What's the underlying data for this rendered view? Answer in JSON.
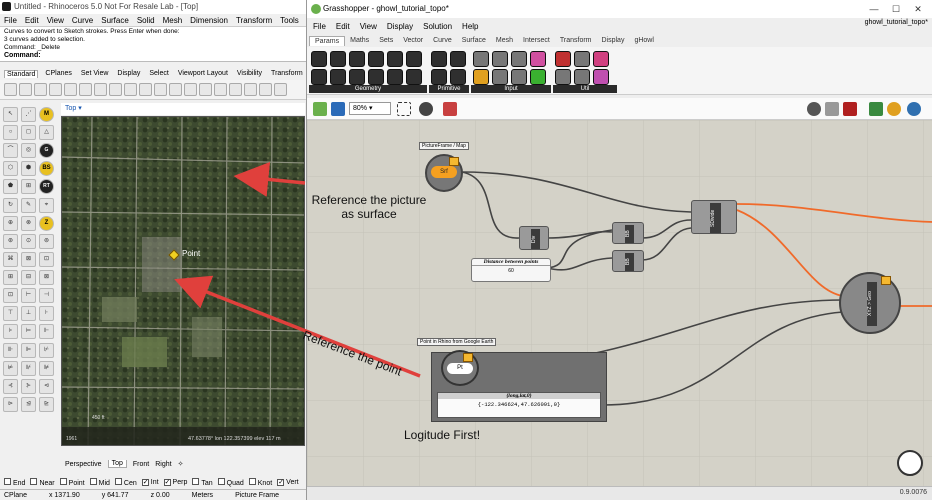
{
  "rhino": {
    "title": "Untitled - Rhinoceros 5.0 Not For Resale Lab - [Top]",
    "menu": [
      "File",
      "Edit",
      "View",
      "Curve",
      "Surface",
      "Solid",
      "Mesh",
      "Dimension",
      "Transform",
      "Tools",
      "Analy"
    ],
    "command_history": [
      "Curves to convert to Sketch strokes. Press Enter when done:",
      "3 curves added to selection.",
      "Command: _Delete"
    ],
    "command_prompt": "Command:",
    "toolbar_tabs": [
      "Standard",
      "CPlanes",
      "Set View",
      "Display",
      "Select",
      "Viewport Layout",
      "Visibility",
      "Transform"
    ],
    "left_tools": [
      "↖",
      "⋰",
      "⌒",
      "○",
      "◻",
      "△",
      "⌒",
      "◎",
      "⊡",
      "⬡",
      "⬢",
      "◆",
      "⬟",
      "⊞",
      "⊟",
      "↻",
      "✎",
      "⌖",
      "⊕",
      "⊗",
      "⊘",
      "⊛",
      "⊙",
      "⊚",
      "⌘",
      "⊠",
      "⊡",
      "⊞",
      "⊟",
      "⊠",
      "⊡",
      "⊢",
      "⊣",
      "⊤",
      "⊥",
      "⊦",
      "⊧",
      "⊨",
      "⊩",
      "⊪",
      "⊫",
      "⊬",
      "⊭",
      "⊮",
      "⊯",
      "⊰",
      "⊱",
      "⊲",
      "⊳",
      "⊴",
      "⊵"
    ],
    "left_tool_badges": [
      "M",
      "G",
      "BS",
      "RT",
      "Z"
    ],
    "viewport_label": "Top",
    "viewport_point_label": "Point",
    "viewport_coords": "47.63778° lon 122.357399 elev 117 m",
    "viewport_year": "1961",
    "viewport_scale": "450 ft",
    "viewport_tabs": [
      "Perspective",
      "Top",
      "Front",
      "Right",
      "✧"
    ],
    "osnaps": [
      {
        "label": "End",
        "on": false
      },
      {
        "label": "Near",
        "on": false
      },
      {
        "label": "Point",
        "on": false
      },
      {
        "label": "Mid",
        "on": false
      },
      {
        "label": "Cen",
        "on": false
      },
      {
        "label": "Int",
        "on": true
      },
      {
        "label": "Perp",
        "on": true
      },
      {
        "label": "Tan",
        "on": false
      },
      {
        "label": "Quad",
        "on": false
      },
      {
        "label": "Knot",
        "on": false
      },
      {
        "label": "Vert",
        "on": true
      }
    ],
    "status": [
      "CPlane",
      "x 1371.90",
      "y 641.77",
      "z 0.00",
      "Meters",
      "Picture Frame"
    ]
  },
  "grasshopper": {
    "title": "Grasshopper - ghowl_tutorial_topo*",
    "document_name": "ghowl_tutorial_topo*",
    "window_buttons": [
      "—",
      "☐",
      "✕"
    ],
    "menu": [
      "File",
      "Edit",
      "View",
      "Display",
      "Solution",
      "Help"
    ],
    "tabs": [
      "Params",
      "Maths",
      "Sets",
      "Vector",
      "Curve",
      "Surface",
      "Mesh",
      "Intersect",
      "Transform",
      "Display",
      "gHowl"
    ],
    "active_tab": "Params",
    "ribbon_panels": [
      "Geometry",
      "Primitive",
      "Input",
      "Util"
    ],
    "zoom": "80%",
    "components": {
      "picture_frame_label": "PictureFrame / Map",
      "srf_param": "Srf",
      "distance_slider_title": "Distance between points",
      "distance_slider_value": "60",
      "point_label": "Point in Rhino from Google Earth",
      "pt_param": "Pt",
      "panel_title": "{long,lat,0}",
      "panel_value": "{-122.346624,47.626091,0}",
      "divide_label": "Div",
      "bb_label": "BB",
      "bb2_label": "BB",
      "sample_label": "SDivide",
      "xyz_geo_label": "XYZ > Geo"
    },
    "version": "0.9.0076"
  },
  "annotations": {
    "reference_picture": "Reference the picture\nas surface",
    "reference_point": "Reference the point",
    "longitude_first": "Logitude First!"
  },
  "colors": {
    "arrow": "#e0403c",
    "wire_orange": "#f06a2a",
    "canvas": "#d4d2c8"
  }
}
